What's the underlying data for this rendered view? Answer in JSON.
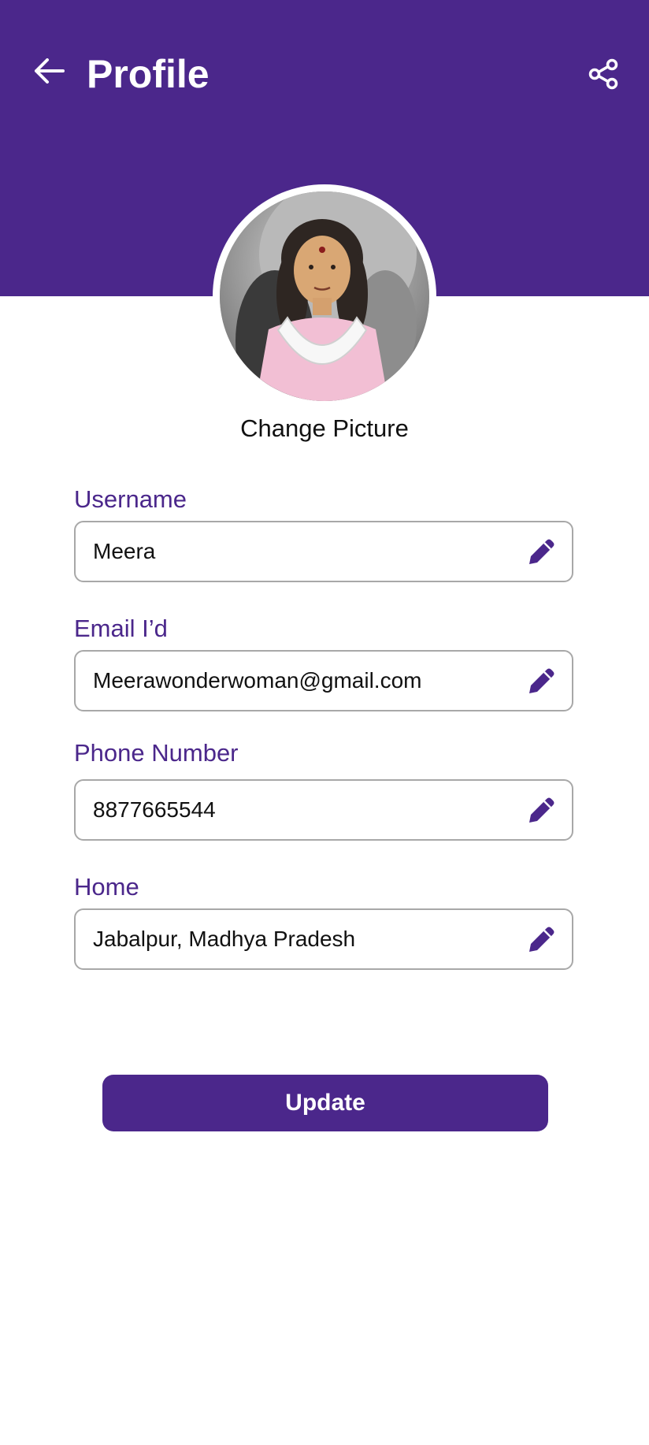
{
  "header": {
    "title": "Profile",
    "back_icon": "arrow-left-icon",
    "share_icon": "share-icon",
    "background_color": "#4b278b"
  },
  "avatar": {
    "change_picture_label": "Change Picture"
  },
  "form": {
    "fields": [
      {
        "label": "Username",
        "value": "Meera",
        "icon": "pencil-icon"
      },
      {
        "label": "Email I’d",
        "value": "Meerawonderwoman@gmail.com",
        "icon": "pencil-icon"
      },
      {
        "label": "Phone Number",
        "value": "8877665544",
        "icon": "pencil-icon"
      },
      {
        "label": "Home",
        "value": "Jabalpur, Madhya Pradesh",
        "icon": "pencil-icon"
      }
    ]
  },
  "actions": {
    "update_label": "Update"
  },
  "theme": {
    "accent": "#4b278b",
    "field_border": "#a8a8a8"
  }
}
